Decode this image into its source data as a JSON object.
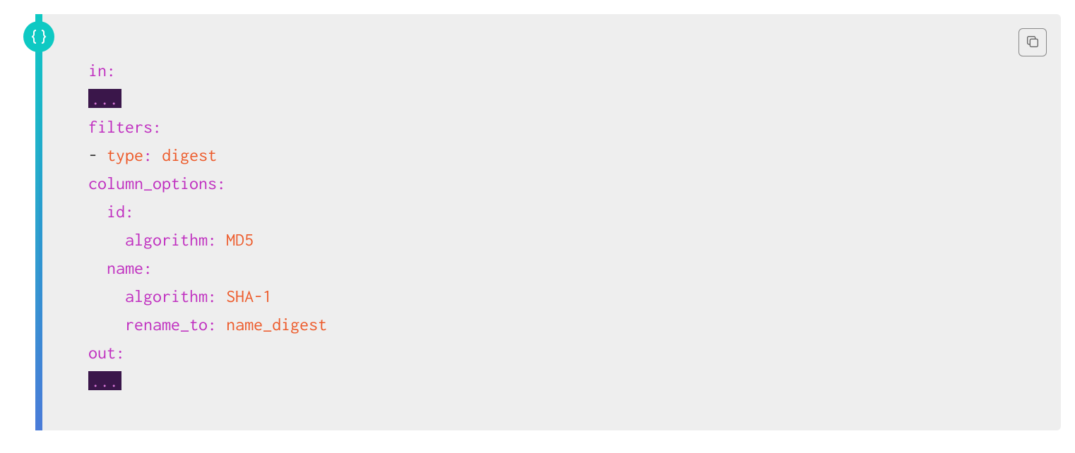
{
  "code": {
    "lines": [
      {
        "indent": 0,
        "segments": [
          {
            "cls": "tok-key",
            "text": "in"
          },
          {
            "cls": "tok-colon",
            "text": ":"
          }
        ]
      },
      {
        "indent": 0,
        "segments": [
          {
            "cls": "tok-ellipsis",
            "text": "..."
          }
        ]
      },
      {
        "indent": 0,
        "segments": [
          {
            "cls": "tok-key",
            "text": "filters"
          },
          {
            "cls": "tok-colon",
            "text": ":"
          }
        ]
      },
      {
        "indent": 0,
        "segments": [
          {
            "cls": "tok-punct",
            "text": "- "
          },
          {
            "cls": "tok-type",
            "text": "type"
          },
          {
            "cls": "tok-colon",
            "text": ":"
          },
          {
            "cls": "tok-punct",
            "text": " "
          },
          {
            "cls": "tok-value",
            "text": "digest"
          }
        ]
      },
      {
        "indent": 0,
        "segments": [
          {
            "cls": "tok-key",
            "text": "column_options"
          },
          {
            "cls": "tok-colon",
            "text": ":"
          }
        ]
      },
      {
        "indent": 1,
        "segments": [
          {
            "cls": "tok-key",
            "text": "id"
          },
          {
            "cls": "tok-colon",
            "text": ":"
          }
        ]
      },
      {
        "indent": 2,
        "segments": [
          {
            "cls": "tok-key",
            "text": "algorithm"
          },
          {
            "cls": "tok-colon",
            "text": ":"
          },
          {
            "cls": "tok-punct",
            "text": " "
          },
          {
            "cls": "tok-value",
            "text": "MD5"
          }
        ]
      },
      {
        "indent": 1,
        "segments": [
          {
            "cls": "tok-key",
            "text": "name"
          },
          {
            "cls": "tok-colon",
            "text": ":"
          }
        ]
      },
      {
        "indent": 2,
        "segments": [
          {
            "cls": "tok-key",
            "text": "algorithm"
          },
          {
            "cls": "tok-colon",
            "text": ":"
          },
          {
            "cls": "tok-punct",
            "text": " "
          },
          {
            "cls": "tok-value",
            "text": "SHA-1"
          }
        ]
      },
      {
        "indent": 2,
        "segments": [
          {
            "cls": "tok-key",
            "text": "rename_to"
          },
          {
            "cls": "tok-colon",
            "text": ":"
          },
          {
            "cls": "tok-punct",
            "text": " "
          },
          {
            "cls": "tok-value",
            "text": "name_digest"
          }
        ]
      },
      {
        "indent": 0,
        "segments": [
          {
            "cls": "tok-key",
            "text": "out"
          },
          {
            "cls": "tok-colon",
            "text": ":"
          }
        ]
      },
      {
        "indent": 0,
        "segments": [
          {
            "cls": "tok-ellipsis",
            "text": "..."
          }
        ]
      }
    ]
  }
}
